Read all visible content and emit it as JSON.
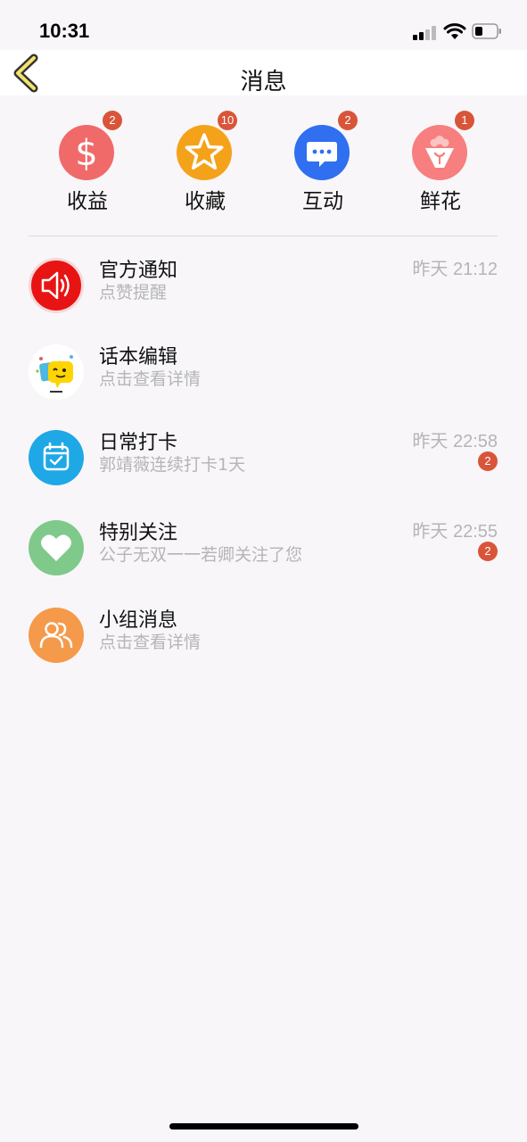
{
  "status_bar": {
    "time": "10:31"
  },
  "header": {
    "title": "消息"
  },
  "categories": [
    {
      "label": "收益",
      "badge": "2",
      "icon": "dollar-icon",
      "color": "#f06a6a"
    },
    {
      "label": "收藏",
      "badge": "10",
      "icon": "star-icon",
      "color": "#f5a21b"
    },
    {
      "label": "互动",
      "badge": "2",
      "icon": "chat-bubble-icon",
      "color": "#2f6ff0"
    },
    {
      "label": "鲜花",
      "badge": "1",
      "icon": "flower-bouquet-icon",
      "color": "#f77f7f"
    }
  ],
  "messages": [
    {
      "title": "官方通知",
      "subtitle": "点赞提醒",
      "time": "昨天 21:12",
      "badge": null,
      "icon": "speaker-icon",
      "color": "#e81414"
    },
    {
      "title": "话本编辑",
      "subtitle": "点击查看详情",
      "time": null,
      "badge": null,
      "icon": "editor-avatar-icon",
      "color": "#ffffff"
    },
    {
      "title": "日常打卡",
      "subtitle": "郭靖薇连续打卡1天",
      "time": "昨天 22:58",
      "badge": "2",
      "icon": "calendar-check-icon",
      "color": "#1ea8e6"
    },
    {
      "title": "特别关注",
      "subtitle": "公子无双一一若卿关注了您",
      "time": "昨天 22:55",
      "badge": "2",
      "icon": "heart-icon",
      "color": "#7fc98a"
    },
    {
      "title": "小组消息",
      "subtitle": "点击查看详情",
      "time": null,
      "badge": null,
      "icon": "group-users-icon",
      "color": "#f59a4a"
    }
  ]
}
